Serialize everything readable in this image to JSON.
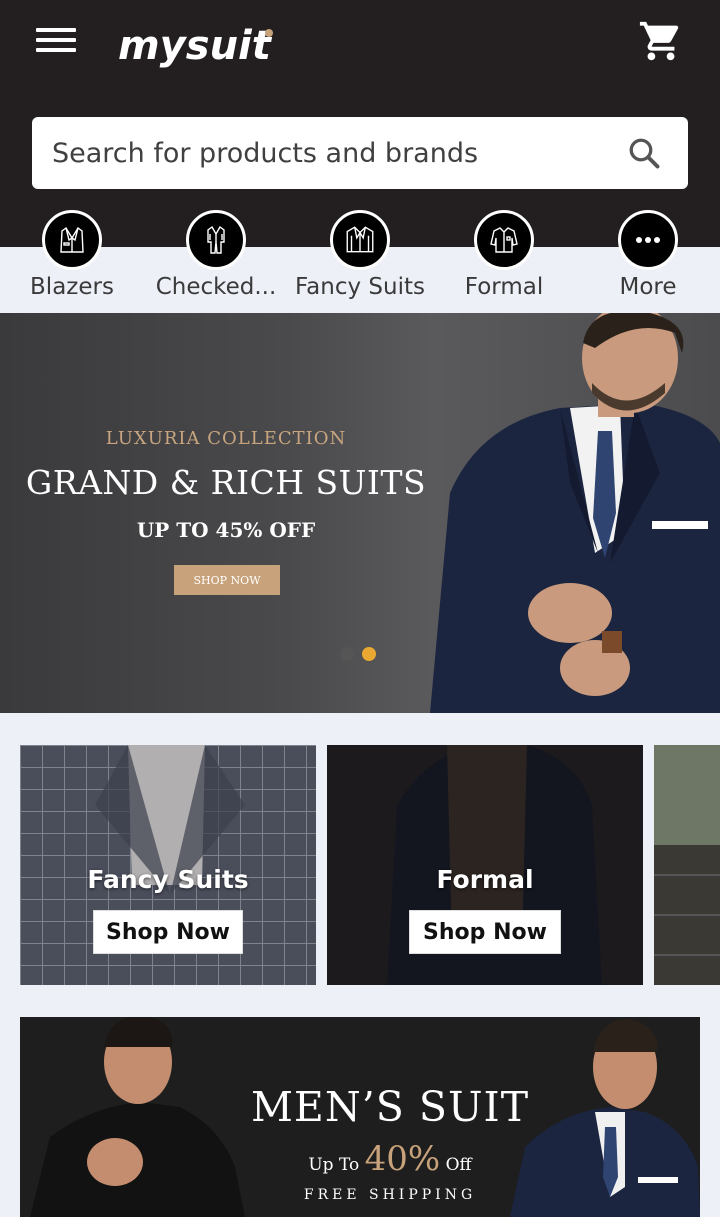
{
  "header": {
    "logo_text": "mysuit",
    "search_placeholder": "Search for products and brands"
  },
  "categories": [
    {
      "label": "Blazers",
      "icon": "blazer-icon"
    },
    {
      "label": "Checked...",
      "icon": "checked-suit-icon"
    },
    {
      "label": "Fancy Suits",
      "icon": "fancy-suit-icon"
    },
    {
      "label": "Formal",
      "icon": "formal-shirt-icon"
    },
    {
      "label": "More",
      "icon": "more-dots-icon"
    }
  ],
  "hero": {
    "subtitle": "LUXURIA COLLECTION",
    "title": "GRAND & RICH SUITS",
    "offer": "UP TO 45% OFF",
    "cta": "SHOP NOW",
    "active_slide": 2,
    "slide_count": 2
  },
  "cards": [
    {
      "title": "Fancy Suits",
      "cta": "Shop Now"
    },
    {
      "title": "Formal",
      "cta": "Shop Now"
    }
  ],
  "banner2": {
    "title": "MEN’S SUIT",
    "offer_prefix": "Up To",
    "offer_value": "40%",
    "offer_suffix": "Off",
    "shipping": "FREE SHIPPING"
  },
  "colors": {
    "header_bg": "#231f20",
    "accent_gold": "#c8a27a",
    "dot_active": "#e8a832",
    "page_bg": "#eef0f8"
  }
}
